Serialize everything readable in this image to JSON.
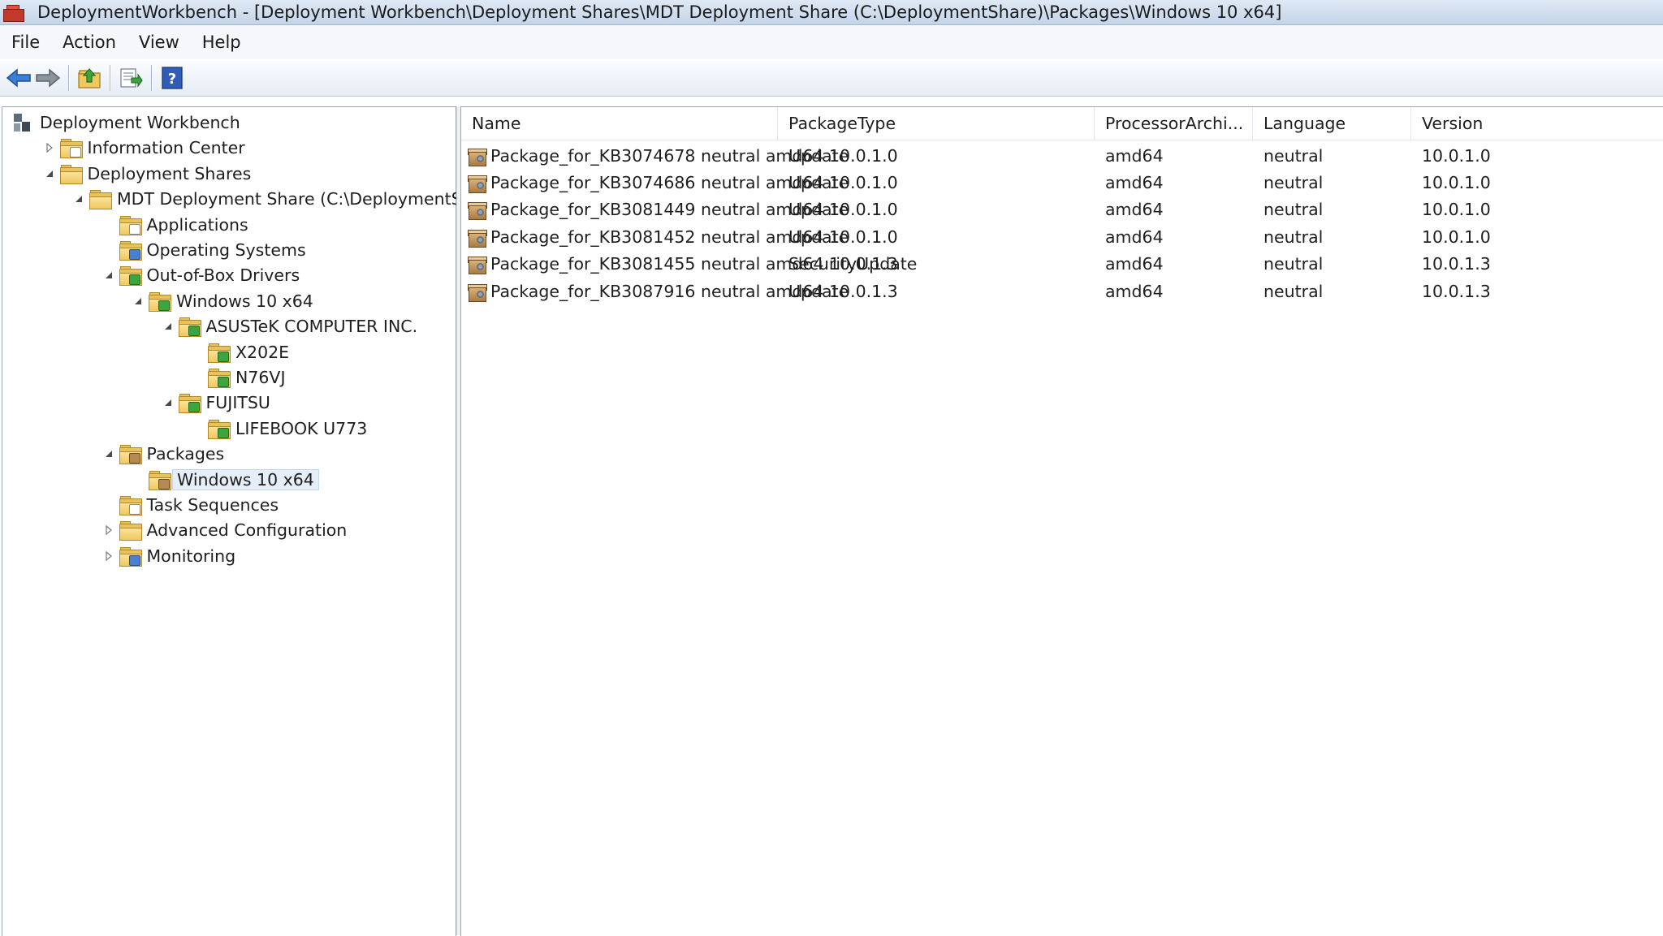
{
  "window": {
    "title": "DeploymentWorkbench - [Deployment Workbench\\Deployment Shares\\MDT Deployment Share (C:\\DeploymentShare)\\Packages\\Windows 10 x64]"
  },
  "menu": [
    "File",
    "Action",
    "View",
    "Help"
  ],
  "toolbar": {
    "icons": [
      "back-arrow-icon",
      "forward-arrow-icon",
      "up-folder-icon",
      "export-list-icon",
      "help-icon"
    ],
    "colors": {
      "arrow": "#3a7fd6",
      "help": "#2f5db8"
    }
  },
  "tree": [
    {
      "label": "Deployment Workbench",
      "icon": "workbench-icon",
      "expander": "none"
    },
    {
      "label": "Information Center",
      "icon": "folder-info-icon",
      "expander": "closed"
    },
    {
      "label": "Deployment Shares",
      "icon": "folder-icon",
      "expander": "open"
    },
    {
      "label": "MDT Deployment Share (C:\\DeploymentS",
      "icon": "deployment-share-icon",
      "expander": "open"
    },
    {
      "label": "Applications",
      "icon": "folder-doc-icon",
      "expander": "none"
    },
    {
      "label": "Operating Systems",
      "icon": "folder-os-icon",
      "expander": "none"
    },
    {
      "label": "Out-of-Box Drivers",
      "icon": "folder-driver-icon",
      "expander": "open"
    },
    {
      "label": "Windows 10 x64",
      "icon": "folder-driver-icon",
      "expander": "open"
    },
    {
      "label": "ASUSTeK COMPUTER INC.",
      "icon": "folder-driver-icon",
      "expander": "open"
    },
    {
      "label": "X202E",
      "icon": "folder-driver-icon",
      "expander": "none"
    },
    {
      "label": "N76VJ",
      "icon": "folder-driver-icon",
      "expander": "none"
    },
    {
      "label": "FUJITSU",
      "icon": "folder-driver-icon",
      "expander": "open"
    },
    {
      "label": "LIFEBOOK U773",
      "icon": "folder-driver-icon",
      "expander": "none"
    },
    {
      "label": "Packages",
      "icon": "folder-package-icon",
      "expander": "open"
    },
    {
      "label": "Windows 10 x64",
      "icon": "folder-package-icon",
      "expander": "none",
      "selected": true
    },
    {
      "label": "Task Sequences",
      "icon": "folder-task-icon",
      "expander": "none"
    },
    {
      "label": "Advanced Configuration",
      "icon": "folder-icon",
      "expander": "closed"
    },
    {
      "label": "Monitoring",
      "icon": "folder-monitor-icon",
      "expander": "closed"
    }
  ],
  "list": {
    "columns": [
      "Name",
      "PackageType",
      "ProcessorArchi...",
      "Language",
      "Version"
    ],
    "rows": [
      [
        "Package_for_KB3074678 neutral amd64 10.0.1.0",
        "Update",
        "amd64",
        "neutral",
        "10.0.1.0"
      ],
      [
        "Package_for_KB3074686 neutral amd64 10.0.1.0",
        "Update",
        "amd64",
        "neutral",
        "10.0.1.0"
      ],
      [
        "Package_for_KB3081449 neutral amd64 10.0.1.0",
        "Update",
        "amd64",
        "neutral",
        "10.0.1.0"
      ],
      [
        "Package_for_KB3081452 neutral amd64 10.0.1.0",
        "Update",
        "amd64",
        "neutral",
        "10.0.1.0"
      ],
      [
        "Package_for_KB3081455 neutral amd64 10.0.1.3",
        "SecurityUpdate",
        "amd64",
        "neutral",
        "10.0.1.3"
      ],
      [
        "Package_for_KB3087916 neutral amd64 10.0.1.3",
        "Update",
        "amd64",
        "neutral",
        "10.0.1.3"
      ]
    ]
  }
}
